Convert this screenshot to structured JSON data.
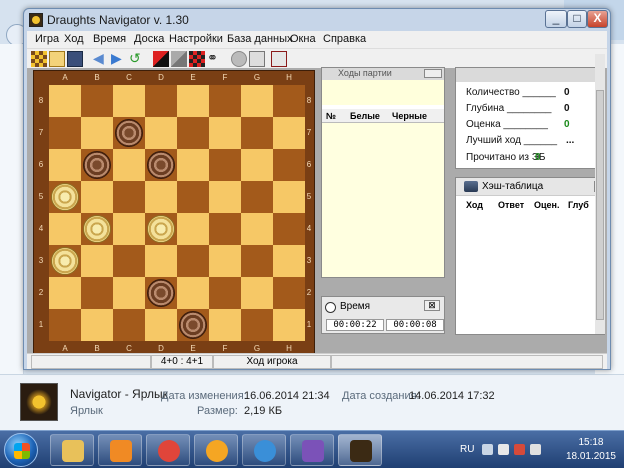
{
  "window": {
    "title": "Draughts Navigator v. 1.30",
    "minimize_label": "_",
    "maximize_label": "□",
    "close_label": "X"
  },
  "menu": [
    "Игра",
    "Ход",
    "Время",
    "Доска",
    "Настройки",
    "База данных",
    "Окна",
    "Справка"
  ],
  "board": {
    "files": [
      "A",
      "B",
      "C",
      "D",
      "E",
      "F",
      "G",
      "H"
    ],
    "ranks": [
      "8",
      "7",
      "6",
      "5",
      "4",
      "3",
      "2",
      "1"
    ],
    "light_color": "#f6c866",
    "dark_color": "#a35a1b",
    "pieces": [
      {
        "square": "c7",
        "color": "black"
      },
      {
        "square": "b6",
        "color": "black"
      },
      {
        "square": "d6",
        "color": "black"
      },
      {
        "square": "a5",
        "color": "white"
      },
      {
        "square": "b4",
        "color": "white"
      },
      {
        "square": "d4",
        "color": "white"
      },
      {
        "square": "a3",
        "color": "white"
      },
      {
        "square": "d2",
        "color": "black"
      },
      {
        "square": "e1",
        "color": "black"
      }
    ]
  },
  "moves_panel": {
    "title": "Ходы партии",
    "columns": [
      "№",
      "Белые",
      "Черные"
    ]
  },
  "time_panel": {
    "title": "Время",
    "close_label": "⊠",
    "white_time": "00:00:22",
    "black_time": "00:00:08"
  },
  "analysis_panel": {
    "rows": [
      {
        "label": "Количество ______",
        "value": "0",
        "color": "#111111"
      },
      {
        "label": "Глубина ________",
        "value": "0",
        "color": "#111111"
      },
      {
        "label": "Оценка ________",
        "value": "0",
        "color": "#1a8a1a"
      },
      {
        "label": "Лучший ход ______",
        "value": "...",
        "color": "#111111"
      },
      {
        "label": "Прочитано из ЭБ",
        "value": "0",
        "color": "#1a8a1a"
      }
    ]
  },
  "hash_panel": {
    "title": "Хэш-таблица",
    "columns": [
      "Ход",
      "Ответ",
      "Оцен.",
      "Глуб"
    ]
  },
  "status_bar": {
    "score": "4+0 : 4+1",
    "state": "Ход игрока"
  },
  "explorer_details": {
    "name": "Navigator - Ярлык",
    "type": "Ярлык",
    "modified_label": "Дата изменения:",
    "modified": "16.06.2014 21:34",
    "size_label": "Размер:",
    "size": "2,19 КБ",
    "created_label": "Дата создания:",
    "created": "14.06.2014 17:32"
  },
  "taskbar": {
    "apps": [
      {
        "name": "explorer",
        "color": "#e8c15a"
      },
      {
        "name": "media-player",
        "color": "#f08a24"
      },
      {
        "name": "chrome",
        "color": "#e0453a"
      },
      {
        "name": "mail-agent",
        "color": "#f5a623"
      },
      {
        "name": "internet-explorer",
        "color": "#3a8fd8"
      },
      {
        "name": "visual-studio",
        "color": "#7b52b8"
      },
      {
        "name": "draughts-navigator",
        "color": "#3b2a14"
      }
    ],
    "language": "RU",
    "time": "15:18",
    "date": "18.01.2015"
  }
}
